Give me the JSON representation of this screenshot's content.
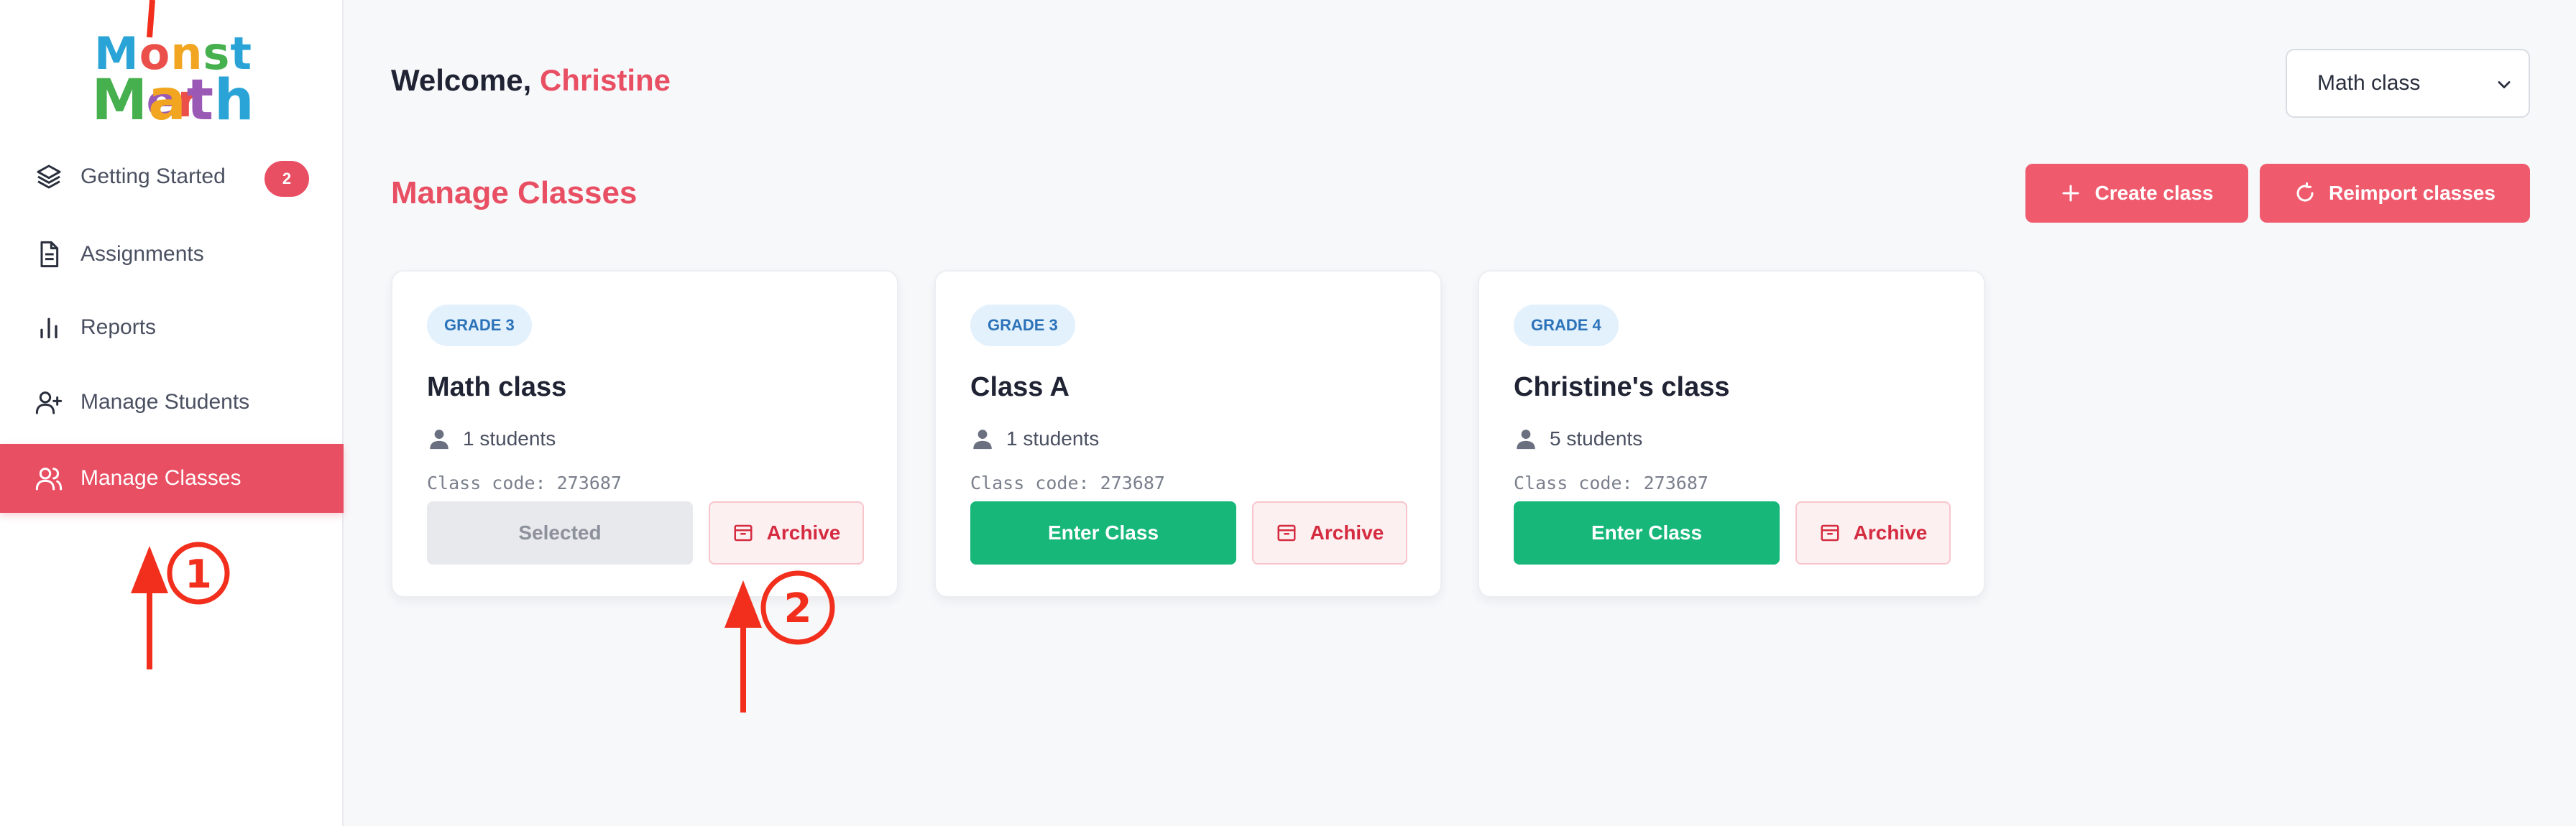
{
  "logo": {
    "line1": [
      "M",
      "o",
      "n",
      "s",
      "t",
      "e",
      "r"
    ],
    "line2": [
      "M",
      "a",
      "t",
      "h"
    ],
    "line1_colors": [
      "#2aa4d6",
      "#ea4f4a",
      "#f1a521",
      "#45b04d",
      "#2aa4d6",
      "#9b59b6",
      "#ea4f4a"
    ],
    "line2_colors": [
      "#45b04d",
      "#f1a521",
      "#9b59b6",
      "#2aa4d6"
    ]
  },
  "sidebar": {
    "items": [
      {
        "label": "Getting Started",
        "icon": "layers-icon",
        "badge": "2"
      },
      {
        "label": "Assignments",
        "icon": "document-icon"
      },
      {
        "label": "Reports",
        "icon": "bar-chart-icon"
      },
      {
        "label": "Manage Students",
        "icon": "add-user-icon"
      },
      {
        "label": "Manage Classes",
        "icon": "users-icon",
        "active": true
      }
    ]
  },
  "header": {
    "welcome_prefix": "Welcome, ",
    "user_name": "Christine",
    "class_select": {
      "selected": "Math class"
    }
  },
  "section": {
    "title": "Manage Classes",
    "create_label": "Create class",
    "reimport_label": "Reimport classes"
  },
  "classes": [
    {
      "grade": "GRADE 3",
      "title": "Math class",
      "students": "1 students",
      "code": "Class code: 273687",
      "primary_label": "Selected",
      "archive_label": "Archive"
    },
    {
      "grade": "GRADE 3",
      "title": "Class A",
      "students": "1 students",
      "code": "Class code: 273687",
      "primary_label": "Enter Class",
      "archive_label": "Archive"
    },
    {
      "grade": "GRADE 4",
      "title": "Christine's class",
      "students": "5 students",
      "code": "Class code: 273687",
      "primary_label": "Enter Class",
      "archive_label": "Archive"
    }
  ],
  "annotations": {
    "step1": "1",
    "step2": "2",
    "color": "#f22f1d"
  },
  "colors": {
    "accent": "#e94f63",
    "enter_button": "#17b77a",
    "grade_badge_text": "#2b72b8"
  }
}
